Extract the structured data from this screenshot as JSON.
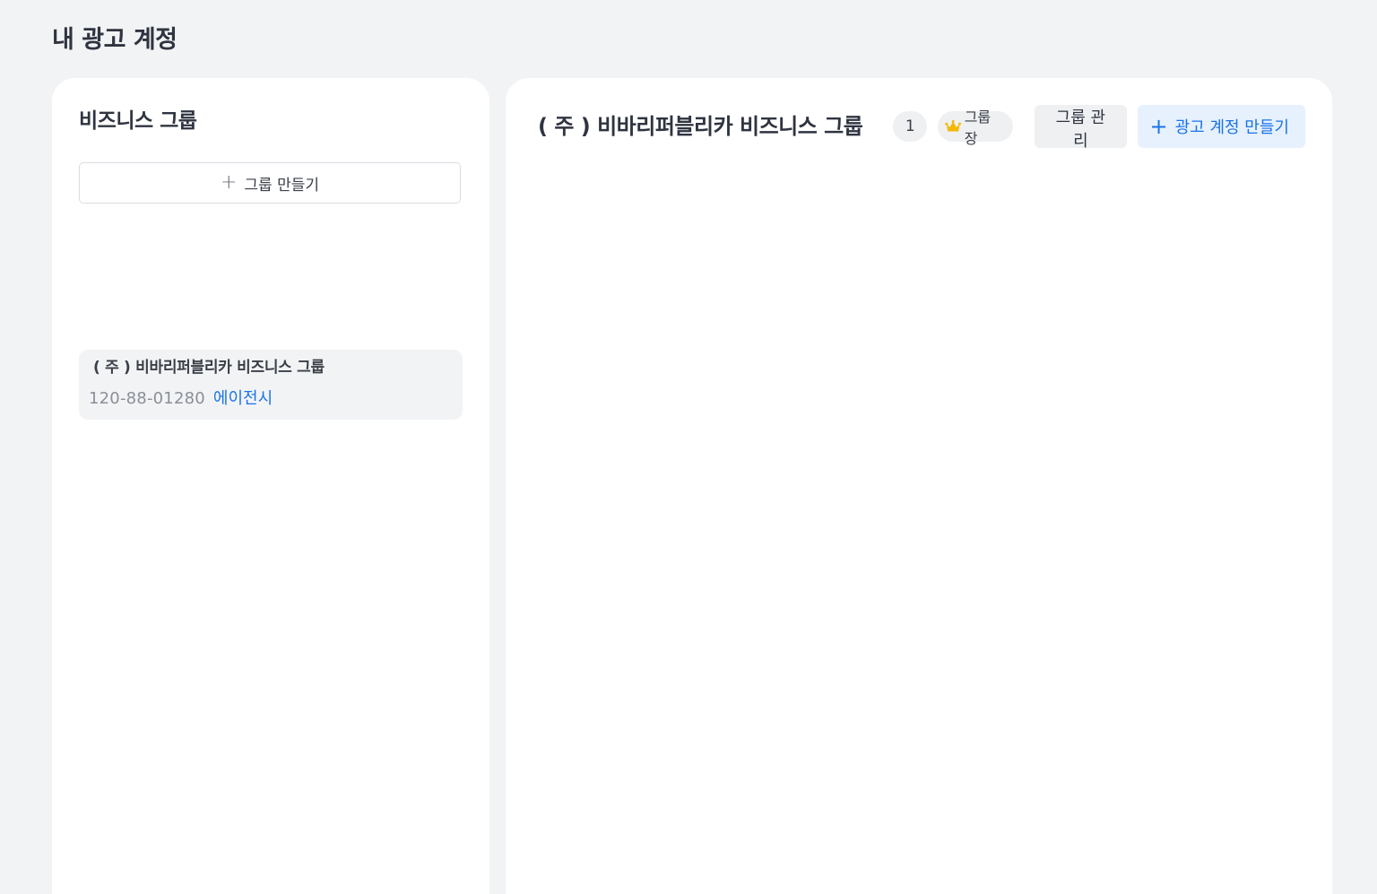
{
  "page": {
    "title": "내 광고 계정"
  },
  "sidebar": {
    "heading": "비즈니스 그룹",
    "create_group_label": "그룹 만들기",
    "groups": [
      {
        "name": "( 주 ) 비바리퍼블리카 비즈니스 그룹",
        "business_number": "120-88-01280",
        "tag": "에이전시"
      }
    ]
  },
  "main": {
    "group_title": "( 주 ) 비바리퍼블리카 비즈니스 그룹",
    "member_count": "1",
    "role_label": "그룹장",
    "manage_label": "그룹 관리",
    "create_account_label": "광고 계정 만들기"
  },
  "icons": {
    "plus": "plus-icon",
    "crown": "crown-icon"
  },
  "colors": {
    "background": "#f2f3f5",
    "panel": "#ffffff",
    "accent": "#1a73e8",
    "accent_bg": "#e6f1fd",
    "crown": "#f5b800"
  }
}
